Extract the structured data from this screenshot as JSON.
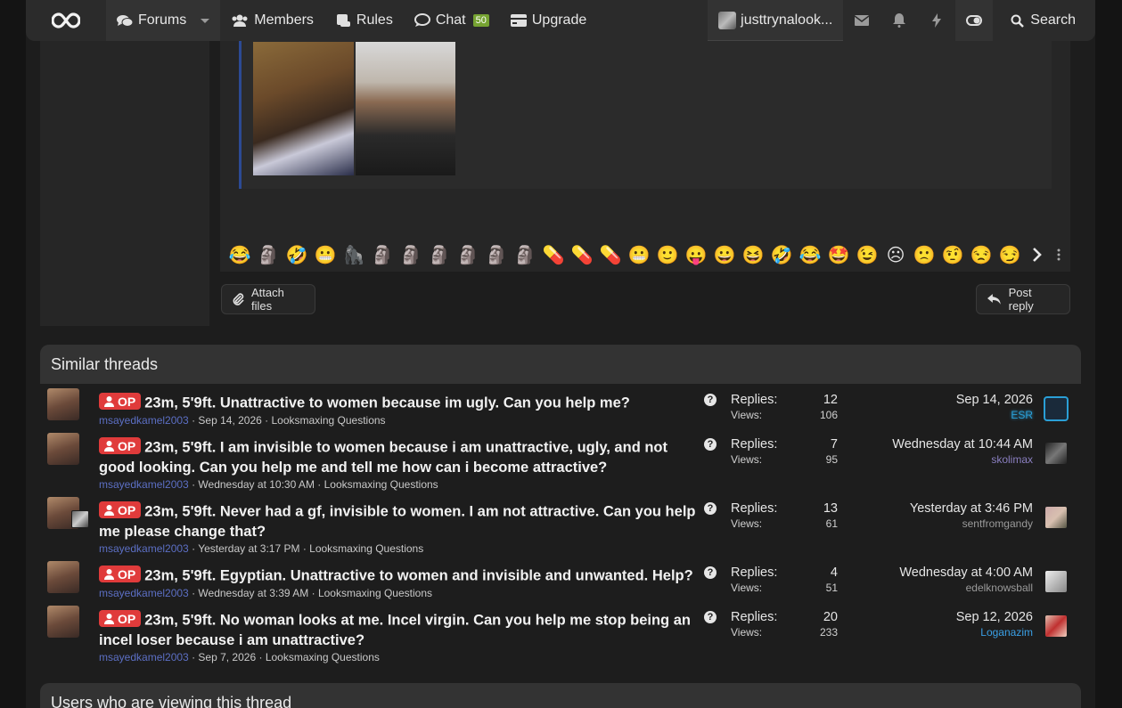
{
  "nav": {
    "forums": "Forums",
    "members": "Members",
    "rules": "Rules",
    "chat": "Chat",
    "chat_count": "50",
    "upgrade": "Upgrade",
    "username": "justtrynalook...",
    "search": "Search"
  },
  "editor": {
    "emojis": [
      "😂",
      "🗿",
      "🤣",
      "😬",
      "🦍",
      "🗿",
      "🗿",
      "🗿",
      "🗿",
      "🗿",
      "🗿",
      "💊",
      "💊",
      "💊",
      "😬",
      "🙂",
      "😛",
      "😀",
      "😆",
      "🤣",
      "😂",
      "🤩",
      "😉",
      "☹",
      "🙁",
      "🤨",
      "😒",
      "😏"
    ],
    "attach_label": "Attach files",
    "post_reply_label": "Post reply"
  },
  "similar": {
    "heading": "Similar threads",
    "op_label": "OP",
    "replies_label": "Replies:",
    "views_label": "Views:",
    "threads": [
      {
        "title": "23m, 5'9ft. Unattractive to women because im ugly. Can you help me?",
        "author": "msayedkamel2003",
        "date": "Sep 14, 2026",
        "forum": "Looksmaxing Questions",
        "replies": "12",
        "views": "106",
        "last_date": "Sep 14, 2026",
        "last_user": "ESR"
      },
      {
        "title": "23m, 5'9ft. I am invisible to women because i am unattractive, ugly, and not good looking. Can you help me and tell me how can i become attractive?",
        "author": "msayedkamel2003",
        "date": "Wednesday at 10:30 AM",
        "forum": "Looksmaxing Questions",
        "replies": "7",
        "views": "95",
        "last_date": "Wednesday at 10:44 AM",
        "last_user": "skolimax"
      },
      {
        "title": "23m, 5'9ft. Never had a gf, invisible to women. I am not attractive. Can you help me please change that?",
        "author": "msayedkamel2003",
        "date": "Yesterday at 3:17 PM",
        "forum": "Looksmaxing Questions",
        "replies": "13",
        "views": "61",
        "last_date": "Yesterday at 3:46 PM",
        "last_user": "sentfromgandy"
      },
      {
        "title": "23m, 5'9ft. Egyptian. Unattractive to women and invisible and unwanted. Help?",
        "author": "msayedkamel2003",
        "date": "Wednesday at 3:39 AM",
        "forum": "Looksmaxing Questions",
        "replies": "4",
        "views": "51",
        "last_date": "Wednesday at 4:00 AM",
        "last_user": "edelknowsball"
      },
      {
        "title": "23m, 5'9ft. No woman looks at me. Incel virgin. Can you help me stop being an incel loser because i am unattractive?",
        "author": "msayedkamel2003",
        "date": "Sep 7, 2026",
        "forum": "Looksmaxing Questions",
        "replies": "20",
        "views": "233",
        "last_date": "Sep 12, 2026",
        "last_user": "Loganazim"
      }
    ]
  },
  "viewers": {
    "heading": "Users who are viewing this thread"
  },
  "colors": {
    "op_badge": "#e03b3b",
    "chat_badge": "#76a332",
    "author_link": "#5c6fc4",
    "quote_border": "#2c4a94"
  }
}
